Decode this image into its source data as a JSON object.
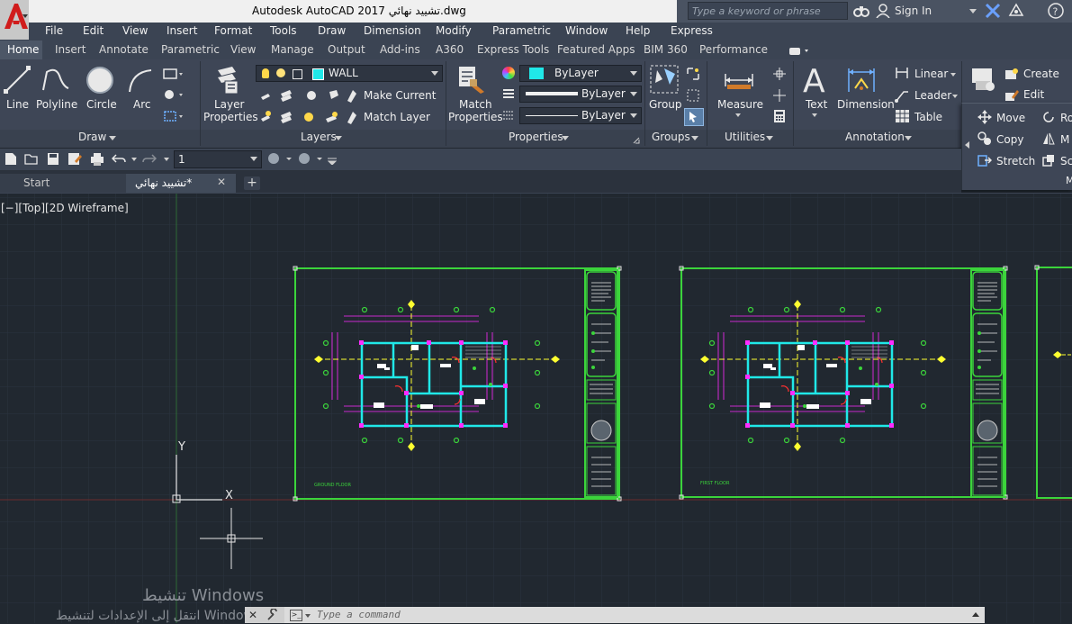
{
  "title_bar": {
    "title": "Autodesk AutoCAD 2017   تشييد نهائي.dwg",
    "search_placeholder": "Type a keyword or phrase",
    "sign_in": "Sign In"
  },
  "menubar": {
    "items": [
      "File",
      "Edit",
      "View",
      "Insert",
      "Format",
      "Tools",
      "Draw",
      "Dimension",
      "Modify",
      "Parametric",
      "Window",
      "Help",
      "Express"
    ]
  },
  "ribbon_tabs": {
    "items": [
      "Home",
      "Insert",
      "Annotate",
      "Parametric",
      "View",
      "Manage",
      "Output",
      "Add-ins",
      "A360",
      "Express Tools",
      "Featured Apps",
      "BIM 360",
      "Performance"
    ],
    "active": "Home"
  },
  "draw_panel": {
    "title": "Draw",
    "tools": [
      "Line",
      "Polyline",
      "Circle",
      "Arc"
    ]
  },
  "layers_panel": {
    "title": "Layers",
    "layer_properties": "Layer\nProperties",
    "layer_properties_l1": "Layer",
    "layer_properties_l2": "Properties",
    "current_layer": "WALL",
    "make_current": "Make Current",
    "match_layer": "Match Layer"
  },
  "properties_panel": {
    "title": "Properties",
    "match_l1": "Match",
    "match_l2": "Properties",
    "color": "ByLayer",
    "lineweight": "ByLayer",
    "linetype": "ByLayer"
  },
  "groups_panel": {
    "title": "Groups",
    "group": "Group"
  },
  "utilities_panel": {
    "title": "Utilities",
    "measure": "Measure"
  },
  "annotation_panel": {
    "title": "Annotation",
    "text": "Text",
    "dimension": "Dimension",
    "linear": "Linear",
    "leader": "Leader",
    "table": "Table"
  },
  "block_panel": {
    "create": "Create",
    "edit": "Edit",
    "insert": "Insert"
  },
  "modify_panel": {
    "move": "Move",
    "copy": "Copy",
    "stretch": "Stretch",
    "rotate": "Ro",
    "mirror": "M",
    "scale": "Sc",
    "title": "M"
  },
  "qat": {
    "layer_value": "1"
  },
  "doc_tabs": {
    "start": "Start",
    "current": "تشييد نهائي*"
  },
  "viewport": {
    "label": "[−][Top][2D Wireframe]",
    "ucs_y": "Y",
    "ucs_x": "X",
    "sheet1_caption": "GROUND FLOOR",
    "sheet2_caption": "FIRST FLOOR"
  },
  "command_line": {
    "placeholder": "Type  a  command"
  },
  "watermark": {
    "line1": "تنشيط Windows",
    "line2": "انتقل إلى الإعدادات لتنشيط Windows."
  },
  "colors": {
    "accent_green": "#3bd43b",
    "cyan": "#20e8e8",
    "magenta": "#ff2bff",
    "yellow": "#ffff30"
  }
}
